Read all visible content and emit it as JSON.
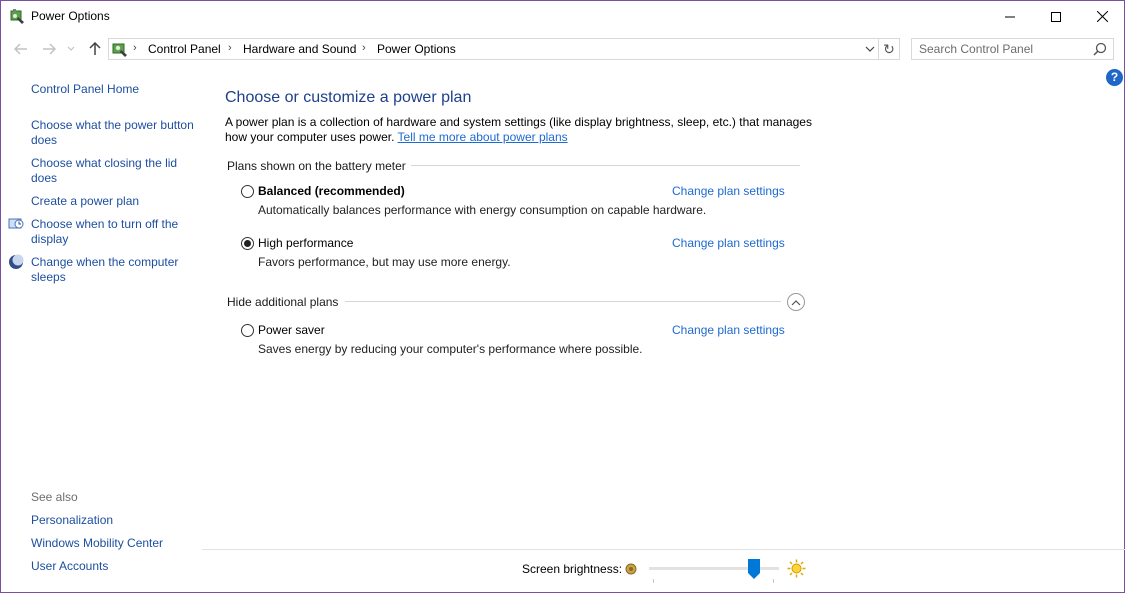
{
  "window": {
    "title": "Power Options"
  },
  "address": {
    "crumbs": [
      "Control Panel",
      "Hardware and Sound",
      "Power Options"
    ]
  },
  "search": {
    "placeholder": "Search Control Panel"
  },
  "help_label": "?",
  "sidebar": {
    "home": "Control Panel Home",
    "links": [
      "Choose what the power button does",
      "Choose what closing the lid does",
      "Create a power plan",
      "Choose when to turn off the display",
      "Change when the computer sleeps"
    ],
    "see_also_title": "See also",
    "see_also": [
      "Personalization",
      "Windows Mobility Center",
      "User Accounts"
    ]
  },
  "main": {
    "title": "Choose or customize a power plan",
    "description": "A power plan is a collection of hardware and system settings (like display brightness, sleep, etc.) that manages how your computer uses power.",
    "learn_more": "Tell me more about power plans",
    "group_battery": "Plans shown on the battery meter",
    "group_hidden": "Hide additional plans",
    "plans": [
      {
        "name": "Balanced (recommended)",
        "description": "Automatically balances performance with energy consumption on capable hardware.",
        "link": "Change plan settings",
        "selected": false
      },
      {
        "name": "High performance",
        "description": "Favors performance, but may use more energy.",
        "link": "Change plan settings",
        "selected": true
      },
      {
        "name": "Power saver",
        "description": "Saves energy by reducing your computer's performance where possible.",
        "link": "Change plan settings",
        "selected": false
      }
    ]
  },
  "brightness": {
    "label": "Screen brightness:",
    "level_percent": 84
  },
  "colors": {
    "link": "#1d4fa0",
    "heading": "#1e3f8a",
    "accent": "#0078d7"
  }
}
